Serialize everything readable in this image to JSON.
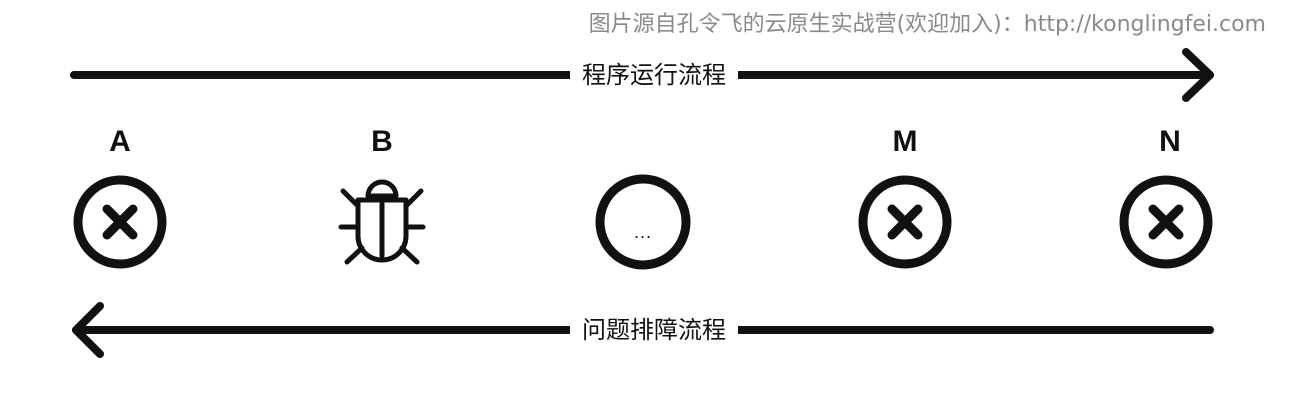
{
  "watermark": "图片源自孔令飞的云原生实战营(欢迎加入)：http://konglingfei.com",
  "top_flow": {
    "label": "程序运行流程"
  },
  "bottom_flow": {
    "label": "问题排障流程"
  },
  "nodes": [
    {
      "label": "A",
      "icon": "x-circle-icon"
    },
    {
      "label": "B",
      "icon": "bug-icon"
    },
    {
      "label": "",
      "icon": "ellipsis-circle-icon",
      "text": "..."
    },
    {
      "label": "M",
      "icon": "x-circle-icon"
    },
    {
      "label": "N",
      "icon": "x-circle-icon"
    }
  ],
  "colors": {
    "stroke": "#111111",
    "background": "#ffffff",
    "watermark": "#8a8a8a"
  }
}
